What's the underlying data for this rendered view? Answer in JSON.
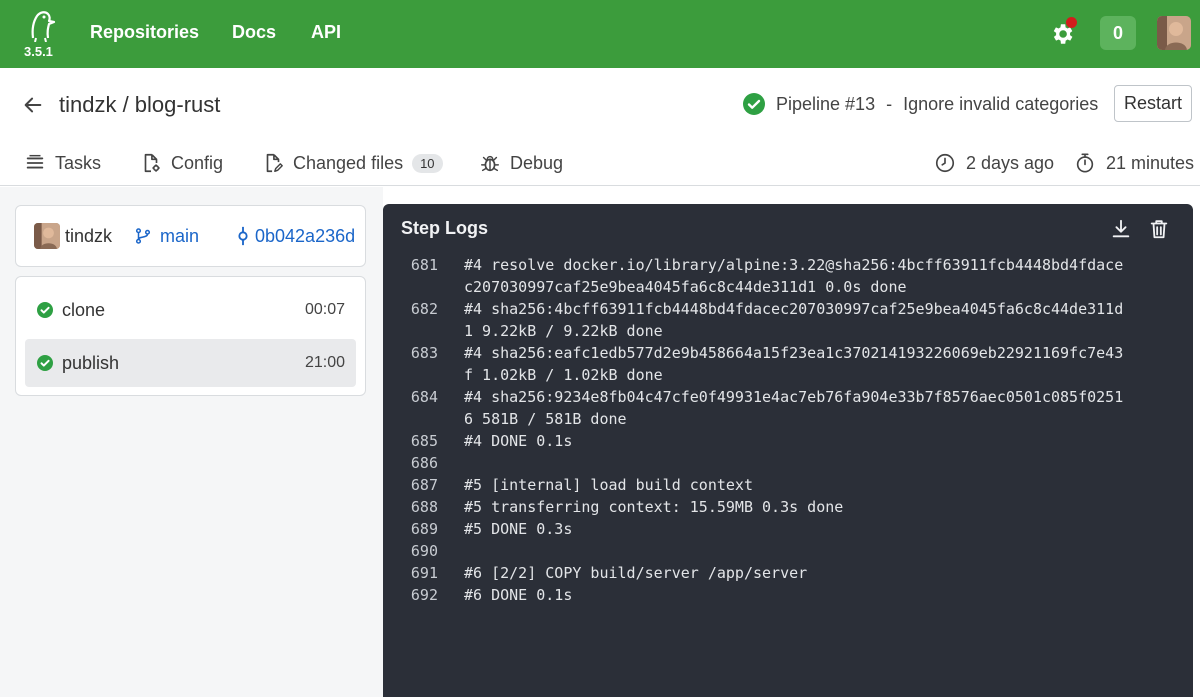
{
  "nav": {
    "version": "3.5.1",
    "links": [
      "Repositories",
      "Docs",
      "API"
    ],
    "notifications_count": "0"
  },
  "header": {
    "repo": "tindzk / blog-rust",
    "pipeline": "Pipeline #13",
    "separator": "-",
    "commit_message": "Ignore invalid categories",
    "restart_label": "Restart",
    "status": "success"
  },
  "tabs": [
    {
      "label": "Tasks",
      "icon": "list-icon"
    },
    {
      "label": "Config",
      "icon": "file-gear-icon"
    },
    {
      "label": "Changed files",
      "icon": "file-edit-icon",
      "count": "10"
    },
    {
      "label": "Debug",
      "icon": "bug-icon"
    }
  ],
  "meta": {
    "created": "2 days ago",
    "duration": "21 minutes"
  },
  "pipeline_info": {
    "author": "tindzk",
    "branch": "main",
    "commit": "0b042a236d"
  },
  "steps": [
    {
      "name": "clone",
      "time": "00:07",
      "status": "success"
    },
    {
      "name": "publish",
      "time": "21:00",
      "status": "success"
    }
  ],
  "logs": {
    "title": "Step Logs",
    "lines": [
      {
        "n": "681",
        "t": "#4 resolve docker.io/library/alpine:3.22@sha256:4bcff63911fcb4448bd4fdacec207030997caf25e9bea4045fa6c8c44de311d1 0.0s done"
      },
      {
        "n": "682",
        "t": "#4 sha256:4bcff63911fcb4448bd4fdacec207030997caf25e9bea4045fa6c8c44de311d1 9.22kB / 9.22kB done"
      },
      {
        "n": "683",
        "t": "#4 sha256:eafc1edb577d2e9b458664a15f23ea1c370214193226069eb22921169fc7e43f 1.02kB / 1.02kB done"
      },
      {
        "n": "684",
        "t": "#4 sha256:9234e8fb04c47cfe0f49931e4ac7eb76fa904e33b7f8576aec0501c085f02516 581B / 581B done"
      },
      {
        "n": "685",
        "t": "#4 DONE 0.1s"
      },
      {
        "n": "686",
        "t": ""
      },
      {
        "n": "687",
        "t": "#5 [internal] load build context"
      },
      {
        "n": "688",
        "t": "#5 transferring context: 15.59MB 0.3s done"
      },
      {
        "n": "689",
        "t": "#5 DONE 0.3s"
      },
      {
        "n": "690",
        "t": ""
      },
      {
        "n": "691",
        "t": "#6 [2/2] COPY build/server /app/server"
      },
      {
        "n": "692",
        "t": "#6 DONE 0.1s"
      }
    ]
  },
  "colors": {
    "brand": "#3c9c3c",
    "success": "#2ea043",
    "link": "#1b66c9",
    "log_bg": "#2b2f38"
  }
}
